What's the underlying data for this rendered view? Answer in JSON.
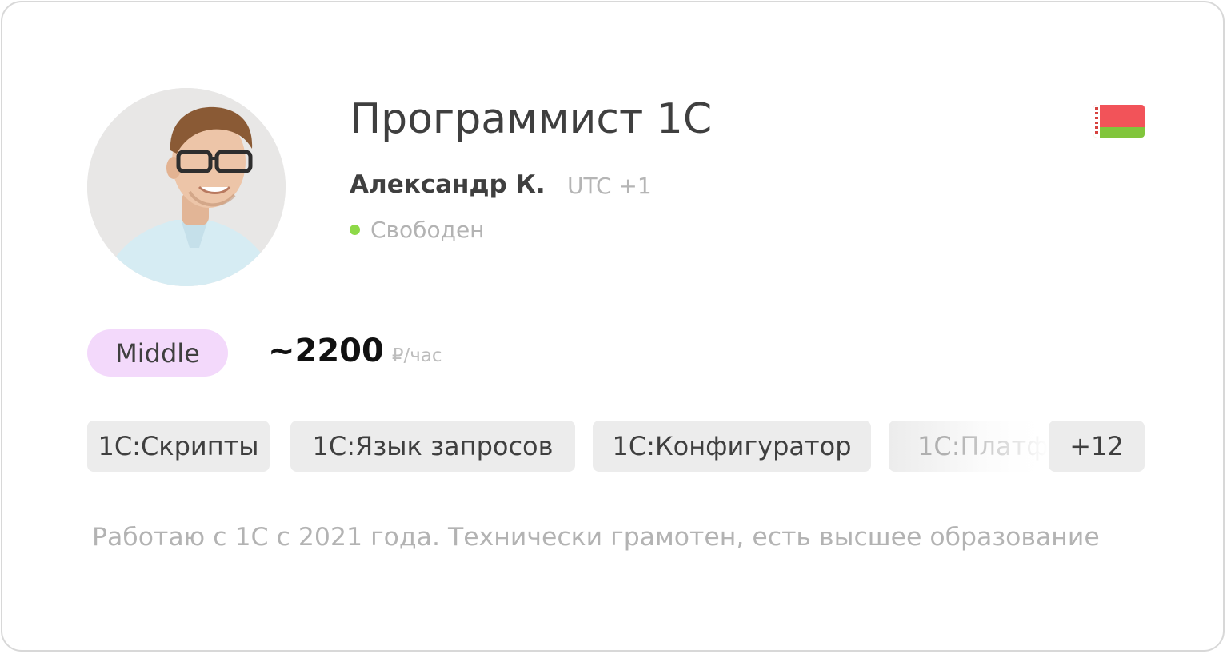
{
  "profile": {
    "title": "Программист 1С",
    "name": "Александр К.",
    "timezone": "UTC +1",
    "status": "Свободен",
    "level": "Middle",
    "rate_value": "~2200",
    "rate_unit": "₽/час",
    "country_flag": "belarus-flag"
  },
  "skills": {
    "items": [
      {
        "label": "1С:Скрипты"
      },
      {
        "label": "1С:Язык запросов"
      },
      {
        "label": "1С:Конфигуратор"
      },
      {
        "label": "1С:Платф"
      }
    ],
    "more_label": "+12"
  },
  "bio": "Работаю с 1С с 2021 года. Технически грамотен, есть высшее образование",
  "colors": {
    "status_dot": "#8ed948",
    "level_badge_bg": "#f3d9fb",
    "tag_bg": "#ececec",
    "flag_red": "#f25359",
    "flag_green": "#81c53b"
  }
}
